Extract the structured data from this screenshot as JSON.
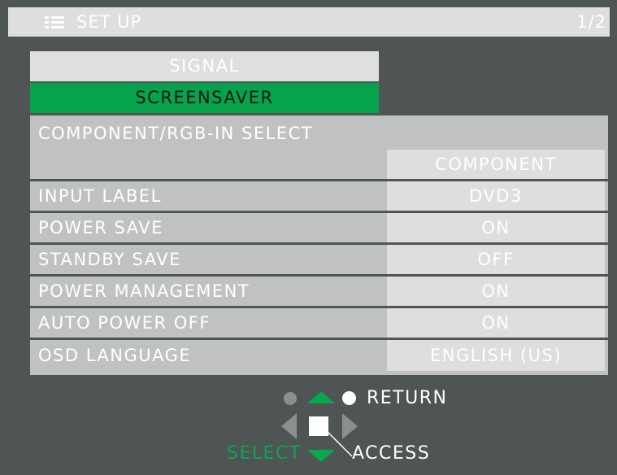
{
  "header": {
    "menu_icon": "menu-list-icon",
    "title": "SET UP",
    "page": "1/2"
  },
  "tabs": [
    {
      "label": "SIGNAL",
      "selected": false
    },
    {
      "label": "SCREENSAVER",
      "selected": true
    }
  ],
  "settings": {
    "component_rgb": {
      "label": "COMPONENT/RGB-IN SELECT",
      "value": "COMPONENT"
    },
    "rows": [
      {
        "label": "INPUT LABEL",
        "value": "DVD3"
      },
      {
        "label": "POWER SAVE",
        "value": "ON"
      },
      {
        "label": "STANDBY SAVE",
        "value": "OFF"
      },
      {
        "label": "POWER MANAGEMENT",
        "value": "ON"
      },
      {
        "label": "AUTO POWER OFF",
        "value": "ON"
      },
      {
        "label": "OSD LANGUAGE",
        "value": "ENGLISH (US)"
      }
    ]
  },
  "navigation": {
    "return_label": "RETURN",
    "select_label": "SELECT",
    "access_label": "ACCESS",
    "icons": [
      "gray-dot-icon",
      "up-arrow-icon",
      "white-dot-icon",
      "left-arrow-icon",
      "enter-button-icon",
      "right-arrow-icon",
      "down-arrow-icon"
    ]
  },
  "colors": {
    "background": "#4f5454",
    "header_bar": "#dddedd",
    "tab_inactive": "#dedfde",
    "tab_selected": "#06a24c",
    "panel": "#c0c2c2",
    "value_box": "#dddedd",
    "accent_green": "#07a84e",
    "text": "#ffffff"
  }
}
